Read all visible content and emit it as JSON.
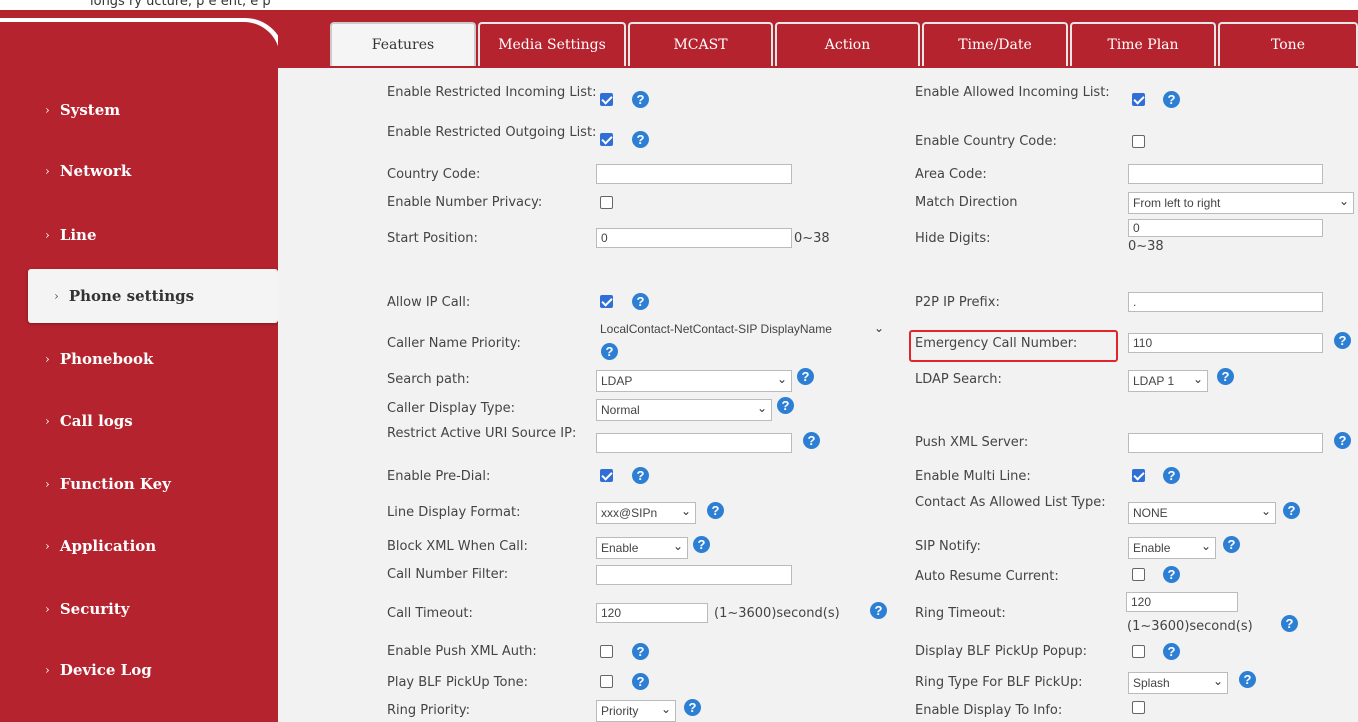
{
  "top_text": "longs ry   ucture, p   e   ent,   e   p",
  "nav": [
    "System",
    "Network",
    "Line",
    "Phone settings",
    "Phonebook",
    "Call logs",
    "Function Key",
    "Application",
    "Security",
    "Device Log"
  ],
  "tabs": [
    "Features",
    "Media Settings",
    "MCAST",
    "Action",
    "Time/Date",
    "Time Plan",
    "Tone"
  ],
  "help_glyph": "?",
  "chevron": "›",
  "arrow": "⌄",
  "left": {
    "restricted_incoming": "Enable Restricted Incoming List:",
    "restricted_outgoing": "Enable Restricted Outgoing List:",
    "country_code": "Country Code:",
    "number_privacy": "Enable Number Privacy:",
    "start_position": "Start Position:",
    "start_position_value": "0",
    "start_position_range": "0~38",
    "allow_ip_call": "Allow IP Call:",
    "caller_name_priority": "Caller Name Priority:",
    "caller_name_priority_value": "LocalContact-NetContact-SIP DisplayName",
    "search_path": "Search path:",
    "search_path_value": "LDAP",
    "caller_display_type": "Caller Display Type:",
    "caller_display_type_value": "Normal",
    "restrict_uri": "Restrict Active URI Source IP:",
    "pre_dial": "Enable Pre-Dial:",
    "line_display_format": "Line Display Format:",
    "line_display_format_value": "xxx@SIPn",
    "block_xml": "Block XML When Call:",
    "block_xml_value": "Enable",
    "call_number_filter": "Call Number Filter:",
    "call_timeout": "Call Timeout:",
    "call_timeout_value": "120",
    "call_timeout_range": "(1~3600)second(s)",
    "push_xml_auth": "Enable Push XML Auth:",
    "blf_tone": "Play BLF PickUp Tone:",
    "ring_priority": "Ring Priority:",
    "ring_priority_value": "Priority"
  },
  "right": {
    "allowed_incoming": "Enable Allowed Incoming List:",
    "country_code": "Enable Country Code:",
    "area_code": "Area Code:",
    "match_direction": "Match Direction",
    "match_direction_value": "From left to right",
    "hide_digits": "Hide Digits:",
    "hide_digits_value": "0",
    "hide_digits_range": "0~38",
    "p2p_prefix": "P2P IP Prefix:",
    "p2p_prefix_value": ".",
    "emergency": "Emergency Call Number:",
    "emergency_value": "110",
    "ldap_search": "LDAP Search:",
    "ldap_search_value": "LDAP 1",
    "push_xml_server": "Push XML Server:",
    "multi_line": "Enable Multi Line:",
    "contact_allowed": "Contact As Allowed List Type:",
    "contact_allowed_value": "NONE",
    "sip_notify": "SIP Notify:",
    "sip_notify_value": "Enable",
    "auto_resume": "Auto Resume Current:",
    "ring_timeout": "Ring Timeout:",
    "ring_timeout_value": "120",
    "ring_timeout_range": "(1~3600)second(s)",
    "blf_popup": "Display BLF PickUp Popup:",
    "ring_type_blf": "Ring Type For BLF PickUp:",
    "ring_type_blf_value": "Splash",
    "display_to_info": "Enable Display To Info:"
  }
}
